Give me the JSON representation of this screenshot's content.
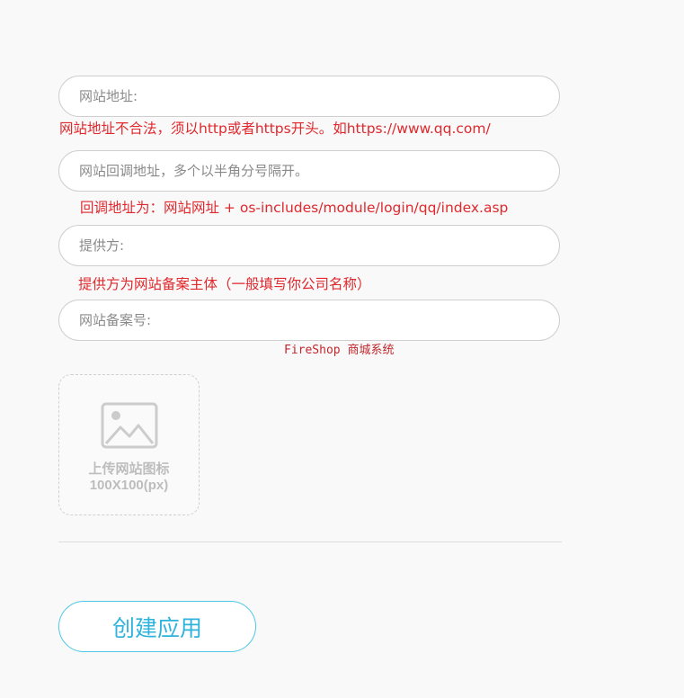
{
  "form": {
    "website_url": {
      "placeholder": "网站地址:",
      "value": "",
      "hint": "网站地址不合法，须以http或者https开头。如https://www.qq.com/"
    },
    "callback_url": {
      "placeholder": "网站回调地址，多个以半角分号隔开。",
      "value": "",
      "hint": "回调地址为：网站网址 + os-includes/module/login/qq/index.asp"
    },
    "provider": {
      "placeholder": "提供方:",
      "value": "",
      "hint": "提供方为网站备案主体（一般填写你公司名称）"
    },
    "icp_number": {
      "placeholder": "网站备案号:",
      "value": ""
    },
    "watermark": "FireShop 商城系统",
    "upload": {
      "icon": "image-icon",
      "label_line1": "上传网站图标",
      "label_line2": "100X100(px)"
    },
    "submit_label": "创建应用"
  },
  "colors": {
    "error": "#e0282d",
    "accent": "#2fb3dc",
    "accent_border": "#4cc7e8",
    "placeholder": "#8a8a8a",
    "upload_text": "#bdbdbd"
  }
}
